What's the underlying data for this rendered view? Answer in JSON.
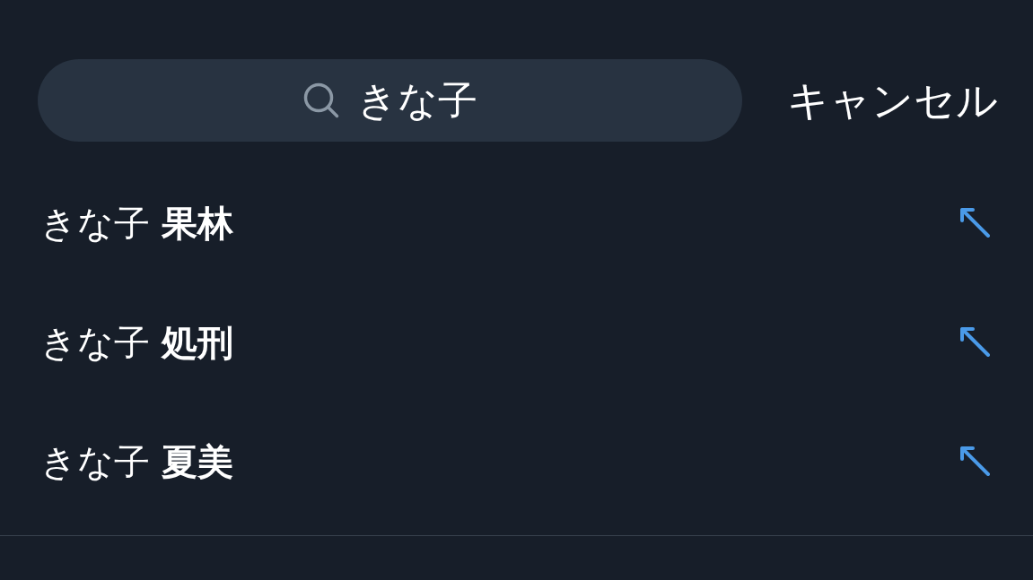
{
  "search": {
    "value": "きな子"
  },
  "cancel_button": "キャンセル",
  "suggestions": [
    {
      "text": "きな子 **果林**"
    },
    {
      "text": "きな子 **処刑**"
    },
    {
      "text": "きな子 **夏美**"
    }
  ]
}
